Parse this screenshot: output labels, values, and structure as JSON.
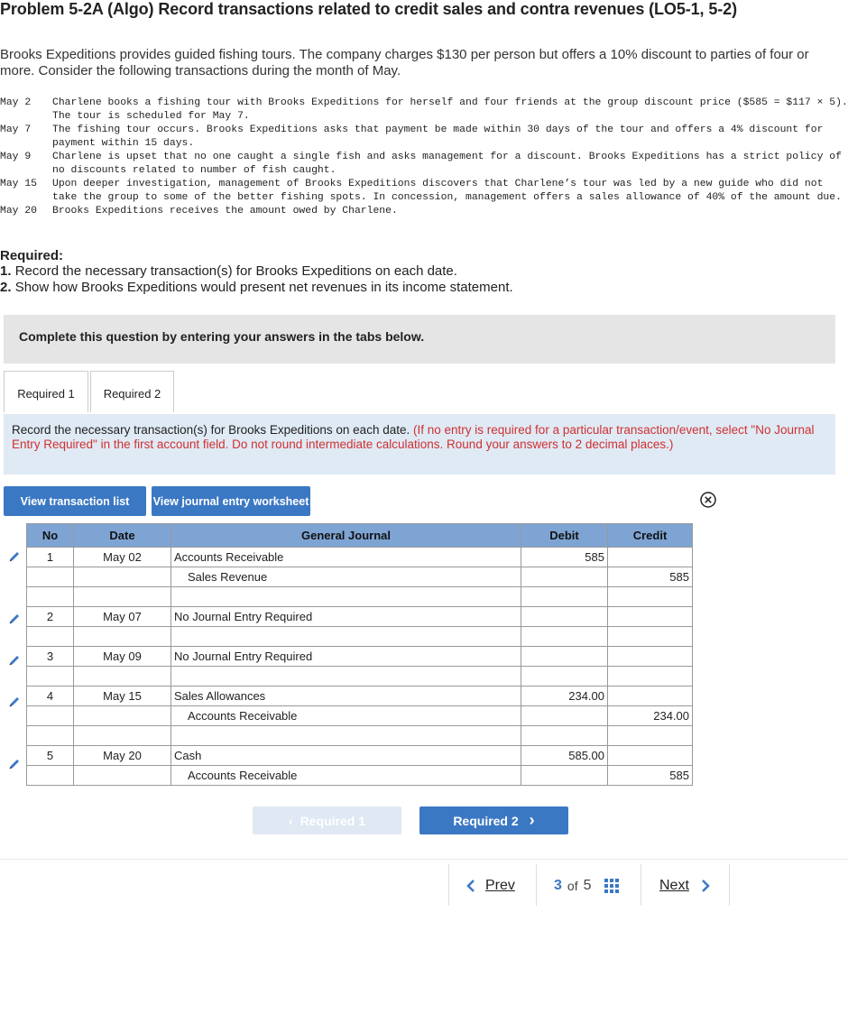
{
  "title": "Problem 5-2A (Algo) Record transactions related to credit sales and contra revenues (LO5-1, 5-2)",
  "intro": "Brooks Expeditions provides guided fishing tours. The company charges $130 per person but offers a 10% discount to parties of four or more. Consider the following transactions during the month of May.",
  "transactions": [
    {
      "date": "May 2",
      "text": "Charlene books a fishing tour with Brooks Expeditions for herself and four friends at the group discount price ($585 = $117 × 5). The tour is scheduled for May 7."
    },
    {
      "date": "May 7",
      "text": "The fishing tour occurs. Brooks Expeditions asks that payment be made within 30 days of the tour and offers a 4% discount for payment within 15 days."
    },
    {
      "date": "May 9",
      "text": "Charlene is upset that no one caught a single fish and asks management for a discount. Brooks Expeditions has a strict policy of no discounts related to number of fish caught."
    },
    {
      "date": "May 15",
      "text": "Upon deeper investigation, management of Brooks Expeditions discovers that Charlene’s tour was led by a new guide who did not take the group to some of the better fishing spots. In concession, management offers a sales allowance of 40% of the amount due."
    },
    {
      "date": "May 20",
      "text": "Brooks Expeditions receives the amount owed by Charlene."
    }
  ],
  "required": {
    "heading": "Required:",
    "items": [
      {
        "num": "1.",
        "text": "Record the necessary transaction(s) for Brooks Expeditions on each date."
      },
      {
        "num": "2.",
        "text": "Show how Brooks Expeditions would present net revenues in its income statement."
      }
    ]
  },
  "complete_banner": "Complete this question by entering your answers in the tabs below.",
  "tabs": [
    {
      "label": "Required 1"
    },
    {
      "label": "Required 2"
    }
  ],
  "instruction": {
    "main": "Record the necessary transaction(s) for Brooks Expeditions on each date.",
    "note": "(If no entry is required for a particular transaction/event, select \"No Journal Entry Required\" in the first account field. Do not round intermediate calculations. Round your answers to 2 decimal places.)"
  },
  "buttons": {
    "view_list": "View transaction list",
    "view_worksheet": "View journal entry worksheet"
  },
  "journal": {
    "headers": {
      "no": "No",
      "date": "Date",
      "gj": "General Journal",
      "debit": "Debit",
      "credit": "Credit"
    },
    "rows": [
      {
        "no": "1",
        "date": "May 02",
        "account": "Accounts Receivable",
        "debit": "585",
        "credit": "",
        "indent": false
      },
      {
        "no": "",
        "date": "",
        "account": "Sales Revenue",
        "debit": "",
        "credit": "585",
        "indent": true
      },
      {
        "no": "",
        "date": "",
        "account": "",
        "debit": "",
        "credit": "",
        "indent": false
      },
      {
        "no": "2",
        "date": "May 07",
        "account": "No Journal Entry Required",
        "debit": "",
        "credit": "",
        "indent": false
      },
      {
        "no": "",
        "date": "",
        "account": "",
        "debit": "",
        "credit": "",
        "indent": false
      },
      {
        "no": "3",
        "date": "May 09",
        "account": "No Journal Entry Required",
        "debit": "",
        "credit": "",
        "indent": false
      },
      {
        "no": "",
        "date": "",
        "account": "",
        "debit": "",
        "credit": "",
        "indent": false
      },
      {
        "no": "4",
        "date": "May 15",
        "account": "Sales Allowances",
        "debit": "234.00",
        "credit": "",
        "indent": false
      },
      {
        "no": "",
        "date": "",
        "account": "Accounts Receivable",
        "debit": "",
        "credit": "234.00",
        "indent": true
      },
      {
        "no": "",
        "date": "",
        "account": "",
        "debit": "",
        "credit": "",
        "indent": false
      },
      {
        "no": "5",
        "date": "May 20",
        "account": "Cash",
        "debit": "585.00",
        "credit": "",
        "indent": false
      },
      {
        "no": "",
        "date": "",
        "account": "Accounts Receivable",
        "debit": "",
        "credit": "585",
        "indent": true
      }
    ]
  },
  "nav": {
    "prev_required": "Required 1",
    "next_required": "Required 2"
  },
  "pager": {
    "prev": "Prev",
    "current": "3",
    "of": "of",
    "total": "5",
    "next": "Next"
  },
  "colors": {
    "accent": "#3b78c4",
    "header_bg": "#7ea4d3",
    "instr_bg": "#dfeaf5",
    "note_red": "#d03030"
  }
}
